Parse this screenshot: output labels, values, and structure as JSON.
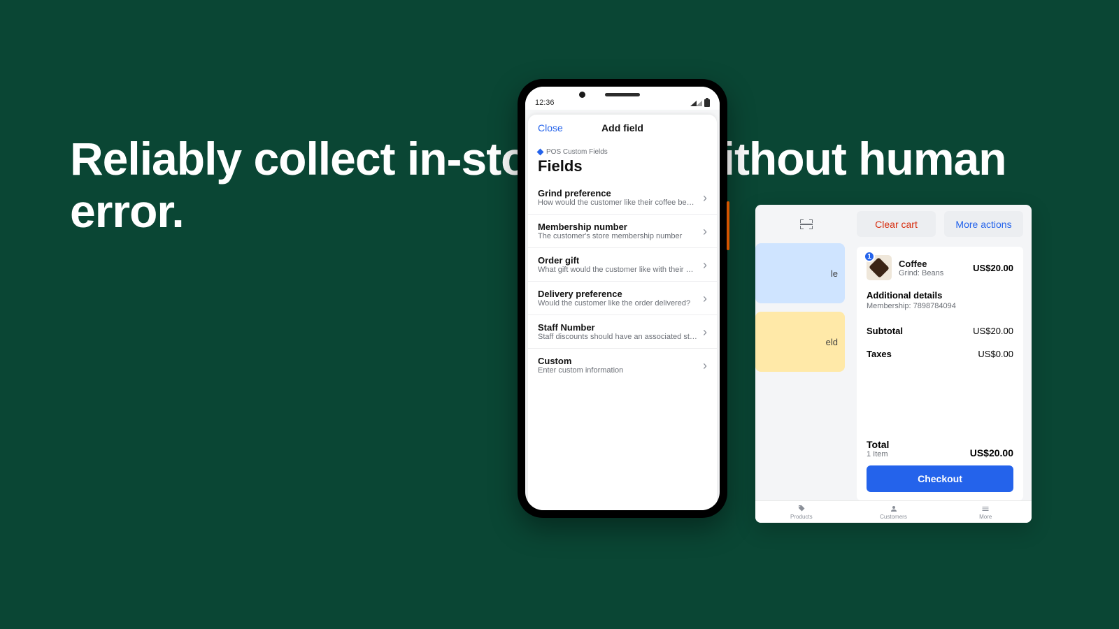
{
  "headline": "Reliably collect in-store data without human error.",
  "phone": {
    "status_time": "12:36",
    "close_label": "Close",
    "header_title": "Add field",
    "breadcrumb": "POS Custom Fields",
    "page_title": "Fields",
    "rows": [
      {
        "name": "Grind preference",
        "desc": "How would the customer like their coffee bean…"
      },
      {
        "name": "Membership number",
        "desc": "The customer's store membership number"
      },
      {
        "name": "Order gift",
        "desc": "What gift would the customer like with their order"
      },
      {
        "name": "Delivery preference",
        "desc": "Would the customer like the order delivered?"
      },
      {
        "name": "Staff Number",
        "desc": "Staff discounts should have an associated sta…"
      },
      {
        "name": "Custom",
        "desc": "Enter custom information"
      }
    ]
  },
  "tablet": {
    "peek_tiles": [
      "le",
      "eld"
    ],
    "clear_label": "Clear cart",
    "more_label": "More actions",
    "item": {
      "badge": "1",
      "name": "Coffee",
      "variant": "Grind: Beans",
      "price": "US$20.00"
    },
    "details_title": "Additional details",
    "details_sub": "Membership: 7898784094",
    "subtotal_label": "Subtotal",
    "subtotal_value": "US$20.00",
    "taxes_label": "Taxes",
    "taxes_value": "US$0.00",
    "total_label": "Total",
    "total_sub": "1 Item",
    "total_value": "US$20.00",
    "checkout_label": "Checkout",
    "tabs": [
      "Products",
      "Customers",
      "More"
    ]
  }
}
